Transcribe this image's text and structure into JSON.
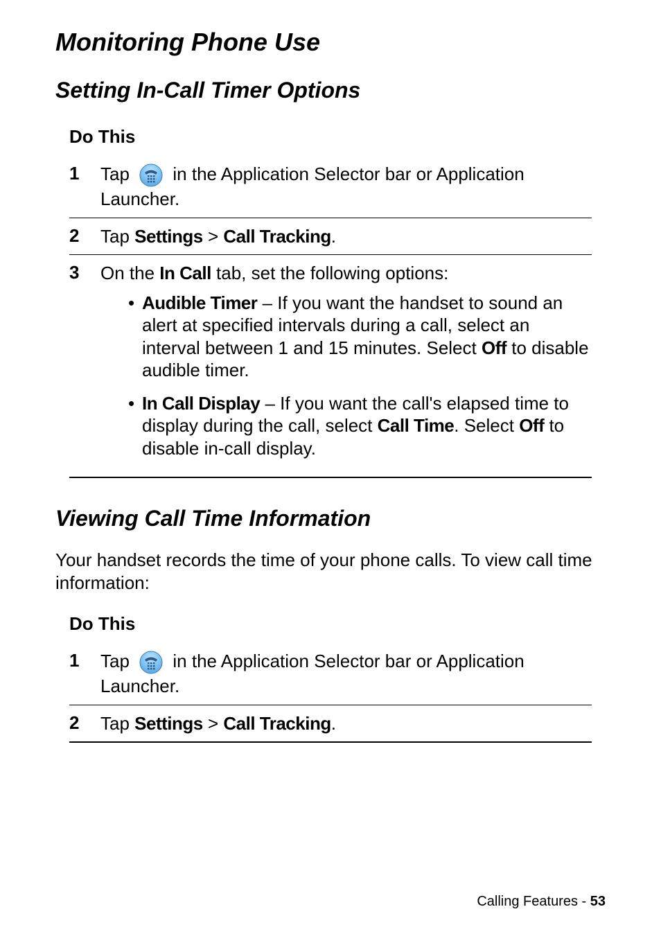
{
  "headings": {
    "h1": "Monitoring Phone Use",
    "h2_1": "Setting In-Call Timer Options",
    "h2_2": "Viewing Call Time Information"
  },
  "table1": {
    "header": "Do This",
    "step1": {
      "num": "1",
      "pre": "Tap ",
      "post": " in the Application Selector bar or Application Launcher."
    },
    "step2": {
      "num": "2",
      "pre": "Tap ",
      "settings": "Settings",
      "gt": " > ",
      "calltracking": "Call Tracking",
      "period": "."
    },
    "step3": {
      "num": "3",
      "pre": "On the ",
      "incall": "In Call",
      "post": " tab, set the following options:",
      "bullet1": {
        "label": "Audible Timer",
        "text1": " – If you want the handset to sound an alert at specified intervals during a call, select an interval between 1 and 15 minutes. Select ",
        "off": "Off",
        "text2": " to disable audible timer."
      },
      "bullet2": {
        "label": "In Call Display",
        "text1": " – If you want the call's elapsed time to display during the call, select ",
        "calltime": "Call Time",
        "text2": ". Select ",
        "off": "Off",
        "text3": " to disable in-call display."
      }
    }
  },
  "paragraph": "Your handset records the time of your phone calls. To view call time information:",
  "table2": {
    "header": "Do This",
    "step1": {
      "num": "1",
      "pre": "Tap ",
      "post": " in the Application Selector bar or Application Launcher."
    },
    "step2": {
      "num": "2",
      "pre": "Tap ",
      "settings": "Settings",
      "gt": " > ",
      "calltracking": "Call Tracking",
      "period": "."
    }
  },
  "footer": {
    "section": "Calling Features - ",
    "page": "53"
  },
  "icons": {
    "phone": "phone-dial-icon"
  }
}
